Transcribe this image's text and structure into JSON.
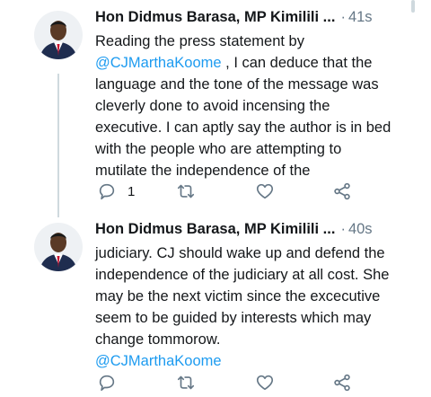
{
  "tweets": [
    {
      "author": "Hon Didmus Barasa, MP Kimilili ...",
      "separator": "·",
      "time": "41s",
      "lines_before": [
        "Reading the press statement by"
      ],
      "mention": "@CJMarthaKoome",
      "after_mention": " , I can deduce that the",
      "lines_after": [
        "language and the tone of the message was",
        "cleverly done to avoid incensing the",
        "executive. I can aptly say the author is in bed",
        "with the people who are attempting to",
        "mutilate the independence of the"
      ],
      "reply_count": "1"
    },
    {
      "author": "Hon Didmus Barasa, MP Kimilili ...",
      "separator": "·",
      "time": "40s",
      "lines": [
        "judiciary. CJ should wake up and defend the",
        "independence of the judiciary at all cost. She",
        "may be the next victim since the excecutive",
        "seem to be guided by interests which may",
        "change tommorow."
      ],
      "mention": "@CJMarthaKoome"
    }
  ],
  "icons": [
    "reply-icon",
    "retweet-icon",
    "like-icon",
    "share-icon"
  ],
  "colors": {
    "mention": "#1d9bf0",
    "muted": "#657786",
    "thread_line": "#cfd9de"
  }
}
